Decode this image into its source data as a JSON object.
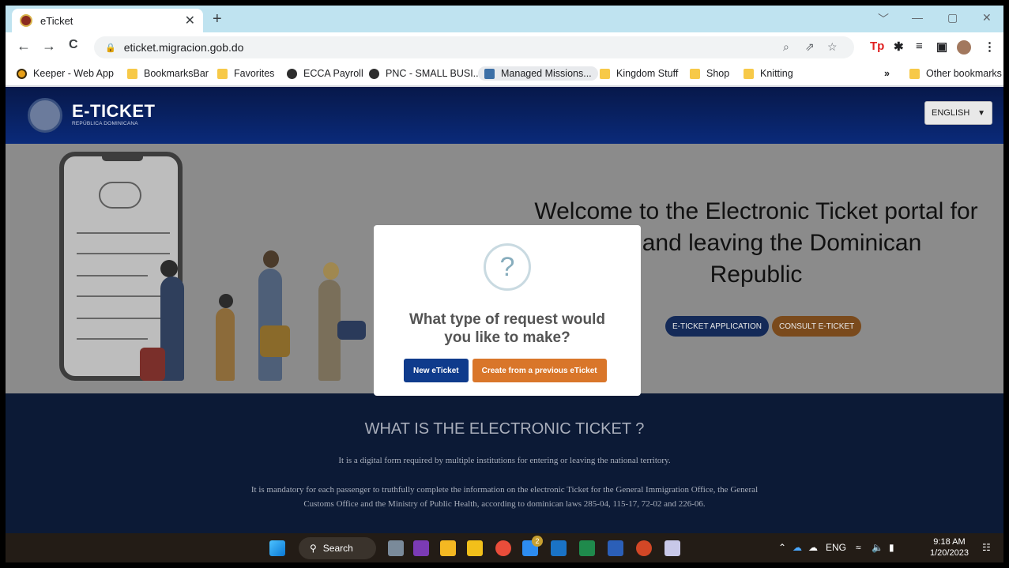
{
  "browser": {
    "tab_title": "eTicket",
    "tab_close": "✕",
    "new_tab": "+",
    "url": "eticket.migracion.gob.do",
    "back": "←",
    "forward": "→",
    "reload": "C",
    "win_min": "—",
    "win_max": "▢",
    "win_close": "✕",
    "win_collapse": "﹀"
  },
  "bookmarks": [
    {
      "label": "Keeper - Web App",
      "icon": "keeper-icon"
    },
    {
      "label": "BookmarksBar",
      "icon": "folder-icon"
    },
    {
      "label": "Favorites",
      "icon": "folder-icon"
    },
    {
      "label": "ECCA Payroll",
      "icon": "globe-icon"
    },
    {
      "label": "PNC - SMALL BUSI...",
      "icon": "globe-icon"
    },
    {
      "label": "Managed Missions...",
      "icon": "managed-missions-icon"
    },
    {
      "label": "Kingdom Stuff",
      "icon": "folder-icon"
    },
    {
      "label": "Shop",
      "icon": "folder-icon"
    },
    {
      "label": "Knitting",
      "icon": "folder-icon"
    }
  ],
  "bookmarks_overflow": "»",
  "other_bookmarks": "Other bookmarks",
  "site": {
    "logo_title": "E-TICKET",
    "logo_subtitle": "REPÚBLICA DOMINICANA",
    "language": "ENGLISH",
    "welcome_line1": "Welcome to the Electronic Ticket portal for",
    "welcome_line2": "g and leaving the Dominican",
    "welcome_line3": "Republic",
    "btn_application": "E-TICKET APPLICATION",
    "btn_consult": "CONSULT E-TICKET",
    "section_title": "WHAT IS THE ELECTRONIC TICKET ?",
    "para1": "It is a digital form required by multiple institutions for entering or leaving the national territory.",
    "para2_line1": "It is mandatory for each passenger to truthfully complete the information on the electronic Ticket for the General Immigration Office, the General",
    "para2_line2": "Customs Office and the Ministry of Public Health, according to dominican laws 285-04, 115-17, 72-02 and 226-06."
  },
  "modal": {
    "icon_text": "?",
    "title_line1": "What type of request would",
    "title_line2": "you like to make?",
    "btn_new": "New eTicket",
    "btn_previous": "Create from a previous eTicket"
  },
  "taskbar": {
    "search_label": "Search",
    "language": "ENG",
    "time": "9:18 AM",
    "date": "1/20/2023",
    "badge": "2"
  },
  "colors": {
    "header_navy": "#07184a",
    "primary_blue": "#0f3b8c",
    "accent_orange": "#d9762a",
    "tabstrip": "#bfe3f0"
  }
}
